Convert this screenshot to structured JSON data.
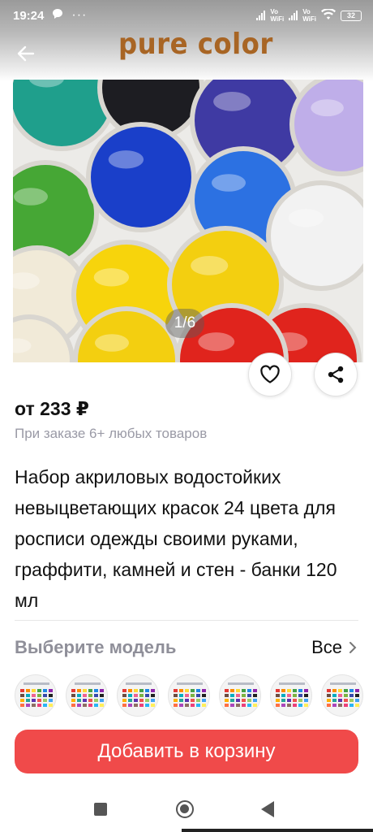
{
  "status_bar": {
    "time": "19:24",
    "net1_top": "Vo",
    "net1_bottom": "WiFi",
    "net2_top": "Vo",
    "net2_bottom": "WiFi",
    "battery": "32",
    "icons": [
      "chat-bubble-icon",
      "more-dots-icon",
      "signal-icon",
      "wifi-icon",
      "battery-icon"
    ]
  },
  "header": {
    "back_icon": "arrow-left-icon",
    "brand": "pure color"
  },
  "gallery": {
    "pager": "1/6",
    "paint_colors": [
      "#1f9f8c",
      "#1d1d22",
      "#3f3aa3",
      "#bfaee9",
      "#46a735",
      "#1a3fc9",
      "#2c71e2",
      "#f2f2f2",
      "#f1ead8",
      "#f7d40c",
      "#f3cf10",
      "#e0241d"
    ]
  },
  "actions": {
    "favorite_icon": "heart-icon",
    "share_icon": "share-icon"
  },
  "product": {
    "price": "от 233 ₽",
    "price_note": "При заказе 6+ любых товаров",
    "title": "Набор акриловых водостойких невыцветающих красок 24 цвета для росписи одежды своими руками, граффити, камней и стен - банки 120 мл"
  },
  "model_selector": {
    "label": "Выберите модель",
    "all": "Все",
    "chevron_icon": "chevron-right-icon",
    "variant_count": 7
  },
  "cart": {
    "label": "Добавить в корзину"
  },
  "nav": {
    "icons": [
      "recents-square-icon",
      "home-circle-icon",
      "back-triangle-icon"
    ]
  }
}
